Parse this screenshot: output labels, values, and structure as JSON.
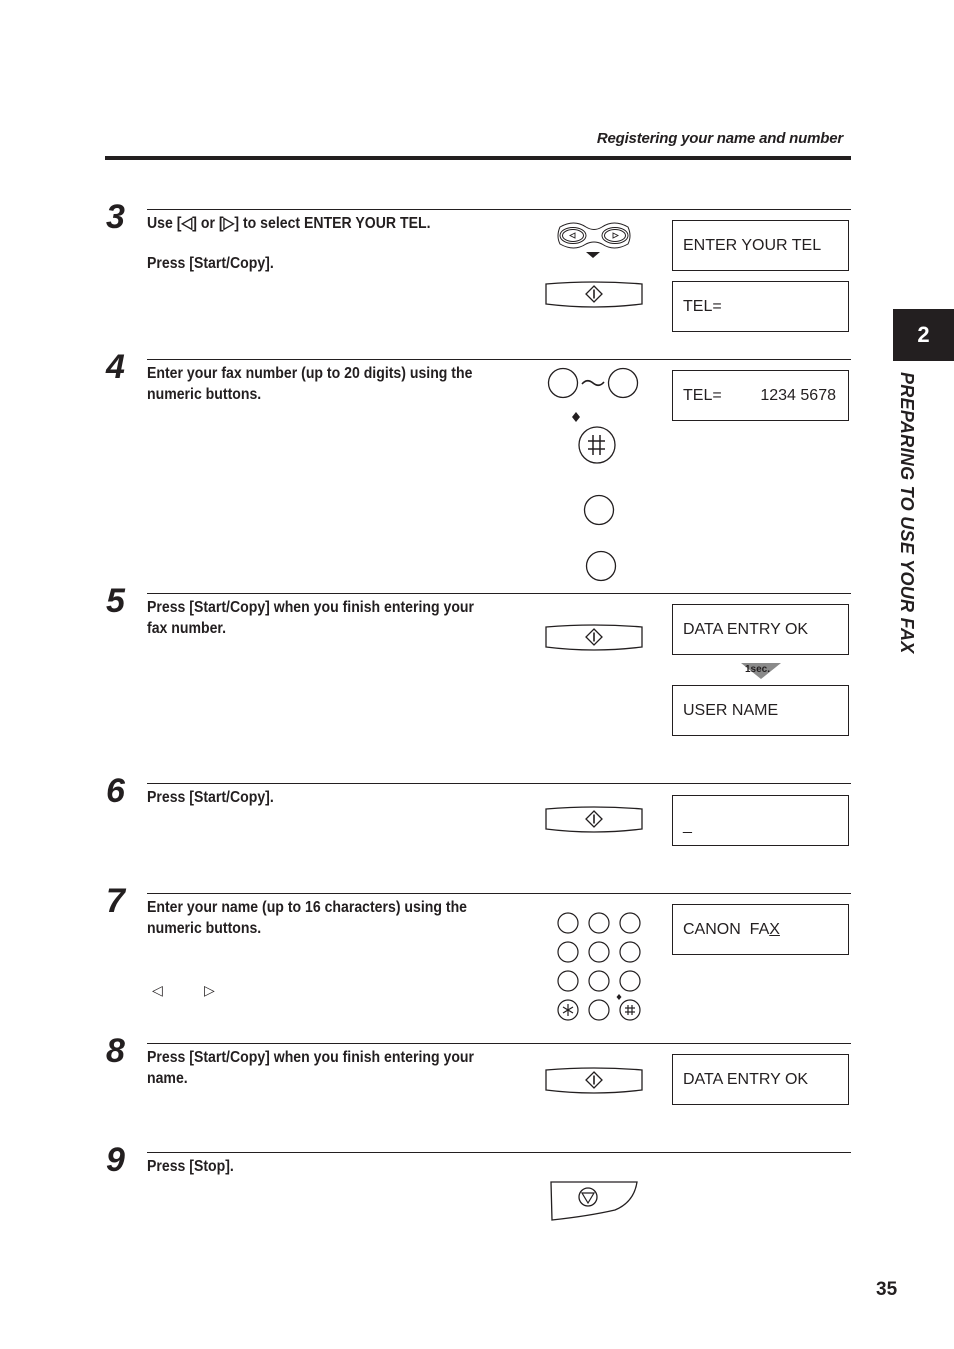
{
  "header": {
    "running_title": "Registering your name and number"
  },
  "side_tab": {
    "chapter_number": "2",
    "chapter_title": "PREPARING TO USE YOUR FAX"
  },
  "page_number": "35",
  "steps": [
    {
      "number": "3",
      "lines": [
        "Use [◁] or [▷] to select ENTER YOUR TEL.",
        "Press [Start/Copy]."
      ],
      "icons": [
        "left-right-arrow-buttons",
        "start-copy-button"
      ],
      "displays": [
        "ENTER YOUR TEL",
        "TEL="
      ]
    },
    {
      "number": "4",
      "lines": [
        "Enter your fax number (up to 20 digits) using the",
        "numeric buttons."
      ],
      "icons": [
        "numeric-button-range",
        "hash-button",
        "numeric-button",
        "numeric-button"
      ],
      "displays": [
        {
          "label": "TEL=",
          "value": "1234 5678"
        }
      ]
    },
    {
      "number": "5",
      "lines": [
        "Press [Start/Copy] when you finish entering your",
        "fax number."
      ],
      "icons": [
        "start-copy-button"
      ],
      "displays": [
        "DATA ENTRY OK",
        "USER NAME"
      ],
      "transition_label": "1sec."
    },
    {
      "number": "6",
      "lines": [
        "Press [Start/Copy]."
      ],
      "icons": [
        "start-copy-button"
      ],
      "displays": [
        "_"
      ]
    },
    {
      "number": "7",
      "lines": [
        "Enter your name (up to 16 characters) using the",
        "numeric buttons."
      ],
      "nav_hint": {
        "left": "◁",
        "right": "▷"
      },
      "icons": [
        "numeric-keypad"
      ],
      "displays": [
        {
          "text": "CANON  FA",
          "cursor_char": "X"
        }
      ]
    },
    {
      "number": "8",
      "lines": [
        "Press [Start/Copy] when you finish entering your",
        "name."
      ],
      "icons": [
        "start-copy-button"
      ],
      "displays": [
        "DATA ENTRY OK"
      ]
    },
    {
      "number": "9",
      "lines": [
        "Press [Stop]."
      ],
      "icons": [
        "stop-button"
      ],
      "displays": []
    }
  ],
  "keypad": {
    "star_symbol": "∗",
    "hash_symbol": "#"
  }
}
